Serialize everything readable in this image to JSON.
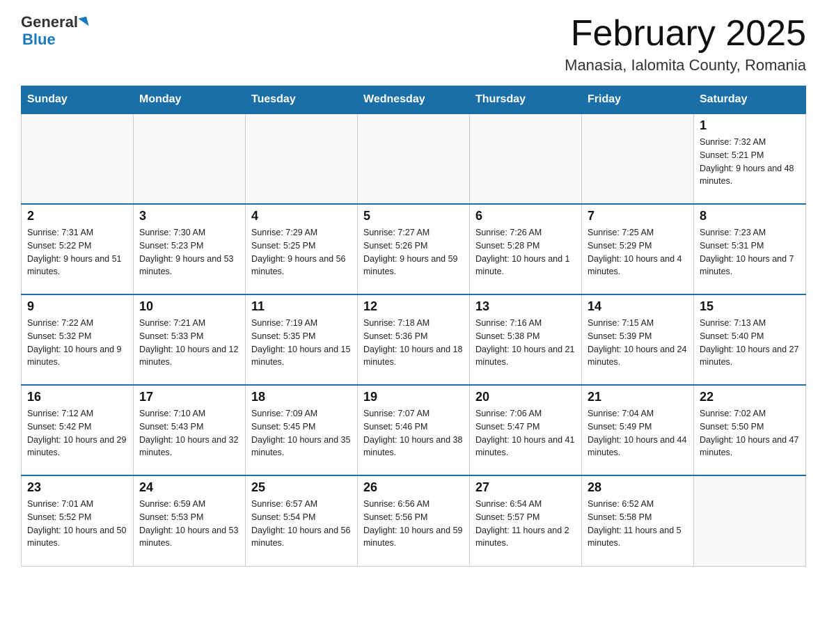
{
  "header": {
    "logo_line1": "General",
    "logo_line2": "Blue",
    "title": "February 2025",
    "subtitle": "Manasia, Ialomita County, Romania"
  },
  "days_of_week": [
    "Sunday",
    "Monday",
    "Tuesday",
    "Wednesday",
    "Thursday",
    "Friday",
    "Saturday"
  ],
  "weeks": [
    [
      {
        "day": "",
        "info": ""
      },
      {
        "day": "",
        "info": ""
      },
      {
        "day": "",
        "info": ""
      },
      {
        "day": "",
        "info": ""
      },
      {
        "day": "",
        "info": ""
      },
      {
        "day": "",
        "info": ""
      },
      {
        "day": "1",
        "info": "Sunrise: 7:32 AM\nSunset: 5:21 PM\nDaylight: 9 hours and 48 minutes."
      }
    ],
    [
      {
        "day": "2",
        "info": "Sunrise: 7:31 AM\nSunset: 5:22 PM\nDaylight: 9 hours and 51 minutes."
      },
      {
        "day": "3",
        "info": "Sunrise: 7:30 AM\nSunset: 5:23 PM\nDaylight: 9 hours and 53 minutes."
      },
      {
        "day": "4",
        "info": "Sunrise: 7:29 AM\nSunset: 5:25 PM\nDaylight: 9 hours and 56 minutes."
      },
      {
        "day": "5",
        "info": "Sunrise: 7:27 AM\nSunset: 5:26 PM\nDaylight: 9 hours and 59 minutes."
      },
      {
        "day": "6",
        "info": "Sunrise: 7:26 AM\nSunset: 5:28 PM\nDaylight: 10 hours and 1 minute."
      },
      {
        "day": "7",
        "info": "Sunrise: 7:25 AM\nSunset: 5:29 PM\nDaylight: 10 hours and 4 minutes."
      },
      {
        "day": "8",
        "info": "Sunrise: 7:23 AM\nSunset: 5:31 PM\nDaylight: 10 hours and 7 minutes."
      }
    ],
    [
      {
        "day": "9",
        "info": "Sunrise: 7:22 AM\nSunset: 5:32 PM\nDaylight: 10 hours and 9 minutes."
      },
      {
        "day": "10",
        "info": "Sunrise: 7:21 AM\nSunset: 5:33 PM\nDaylight: 10 hours and 12 minutes."
      },
      {
        "day": "11",
        "info": "Sunrise: 7:19 AM\nSunset: 5:35 PM\nDaylight: 10 hours and 15 minutes."
      },
      {
        "day": "12",
        "info": "Sunrise: 7:18 AM\nSunset: 5:36 PM\nDaylight: 10 hours and 18 minutes."
      },
      {
        "day": "13",
        "info": "Sunrise: 7:16 AM\nSunset: 5:38 PM\nDaylight: 10 hours and 21 minutes."
      },
      {
        "day": "14",
        "info": "Sunrise: 7:15 AM\nSunset: 5:39 PM\nDaylight: 10 hours and 24 minutes."
      },
      {
        "day": "15",
        "info": "Sunrise: 7:13 AM\nSunset: 5:40 PM\nDaylight: 10 hours and 27 minutes."
      }
    ],
    [
      {
        "day": "16",
        "info": "Sunrise: 7:12 AM\nSunset: 5:42 PM\nDaylight: 10 hours and 29 minutes."
      },
      {
        "day": "17",
        "info": "Sunrise: 7:10 AM\nSunset: 5:43 PM\nDaylight: 10 hours and 32 minutes."
      },
      {
        "day": "18",
        "info": "Sunrise: 7:09 AM\nSunset: 5:45 PM\nDaylight: 10 hours and 35 minutes."
      },
      {
        "day": "19",
        "info": "Sunrise: 7:07 AM\nSunset: 5:46 PM\nDaylight: 10 hours and 38 minutes."
      },
      {
        "day": "20",
        "info": "Sunrise: 7:06 AM\nSunset: 5:47 PM\nDaylight: 10 hours and 41 minutes."
      },
      {
        "day": "21",
        "info": "Sunrise: 7:04 AM\nSunset: 5:49 PM\nDaylight: 10 hours and 44 minutes."
      },
      {
        "day": "22",
        "info": "Sunrise: 7:02 AM\nSunset: 5:50 PM\nDaylight: 10 hours and 47 minutes."
      }
    ],
    [
      {
        "day": "23",
        "info": "Sunrise: 7:01 AM\nSunset: 5:52 PM\nDaylight: 10 hours and 50 minutes."
      },
      {
        "day": "24",
        "info": "Sunrise: 6:59 AM\nSunset: 5:53 PM\nDaylight: 10 hours and 53 minutes."
      },
      {
        "day": "25",
        "info": "Sunrise: 6:57 AM\nSunset: 5:54 PM\nDaylight: 10 hours and 56 minutes."
      },
      {
        "day": "26",
        "info": "Sunrise: 6:56 AM\nSunset: 5:56 PM\nDaylight: 10 hours and 59 minutes."
      },
      {
        "day": "27",
        "info": "Sunrise: 6:54 AM\nSunset: 5:57 PM\nDaylight: 11 hours and 2 minutes."
      },
      {
        "day": "28",
        "info": "Sunrise: 6:52 AM\nSunset: 5:58 PM\nDaylight: 11 hours and 5 minutes."
      },
      {
        "day": "",
        "info": ""
      }
    ]
  ]
}
